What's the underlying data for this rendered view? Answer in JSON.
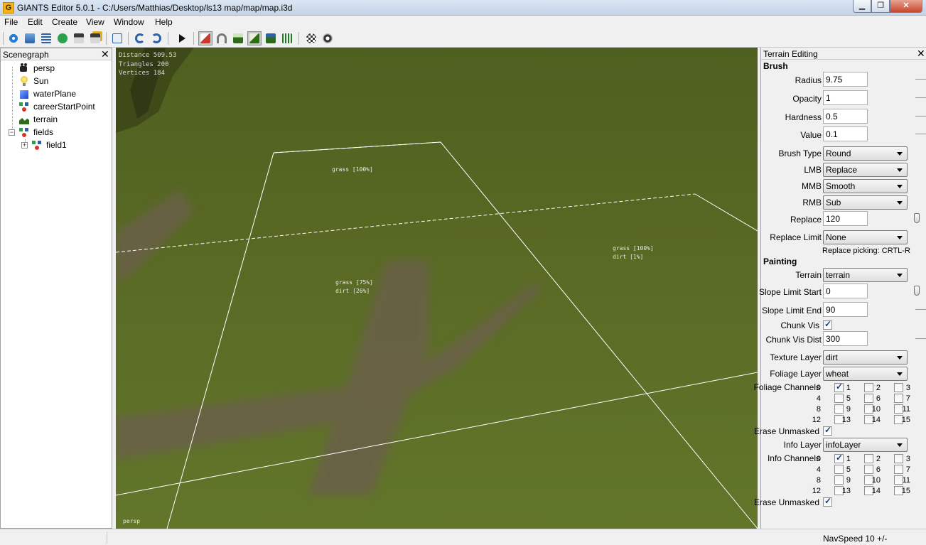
{
  "window": {
    "title": "GIANTS Editor 5.0.1 - C:/Users/Matthias/Desktop/ls13 map/map/map.i3d",
    "app_icon_letter": "G"
  },
  "menu": [
    "File",
    "Edit",
    "Create",
    "View",
    "Window",
    "Help"
  ],
  "toolbar": {
    "icons": [
      "new-scene-icon",
      "open-icon",
      "script-icon",
      "refresh-icon",
      "save-icon",
      "save-as-icon",
      "import-icon",
      "undo-icon",
      "redo-icon",
      "play-icon",
      "select-mode-icon",
      "move-mode-icon",
      "terrain-sculpt-icon",
      "terrain-paint-icon",
      "terrain-foliage-icon",
      "foliage-paint-icon",
      "particle-icon",
      "render-icon"
    ],
    "active": [
      "select-mode-icon",
      "terrain-paint-icon"
    ]
  },
  "scenegraph": {
    "title": "Scenegraph",
    "close": "✕",
    "nodes": [
      {
        "label": "persp",
        "icon": "camera-icon"
      },
      {
        "label": "Sun",
        "icon": "light-bulb-icon"
      },
      {
        "label": "waterPlane",
        "icon": "cube-icon"
      },
      {
        "label": "careerStartPoint",
        "icon": "transform-group-icon"
      },
      {
        "label": "terrain",
        "icon": "terrain-icon"
      },
      {
        "label": "fields",
        "icon": "transform-group-icon"
      },
      {
        "label": "field1",
        "icon": "transform-group-icon"
      }
    ]
  },
  "viewport": {
    "stats": {
      "distance": "Distance 509.53",
      "triangles": "Triangles 200",
      "vertices": "Vertices 184"
    },
    "labels": [
      {
        "line1": "grass [100%]",
        "line2": ""
      },
      {
        "line1": "grass [75%]",
        "line2": "dirt [26%]"
      },
      {
        "line1": "grass [100%]",
        "line2": "dirt [1%]"
      }
    ],
    "camera": "persp"
  },
  "terrain_editing": {
    "title": "Terrain Editing",
    "close": "✕",
    "brush_heading": "Brush",
    "radius_label": "Radius",
    "radius": "9.75",
    "opacity_label": "Opacity",
    "opacity": "1",
    "hardness_label": "Hardness",
    "hardness": "0.5",
    "value_label": "Value",
    "value": "0.1",
    "brush_type_label": "Brush Type",
    "brush_type": "Round",
    "lmb_label": "LMB",
    "lmb": "Replace",
    "mmb_label": "MMB",
    "mmb": "Smooth",
    "rmb_label": "RMB",
    "rmb": "Sub",
    "replace_label": "Replace",
    "replace": "120",
    "replace_limit_label": "Replace Limit",
    "replace_limit": "None",
    "replace_picking": "Replace picking: CRTL-R",
    "painting_heading": "Painting",
    "terrain_label": "Terrain",
    "terrain": "terrain",
    "slope_start_label": "Slope Limit Start",
    "slope_start": "0",
    "slope_end_label": "Slope Limit End",
    "slope_end": "90",
    "chunk_vis_label": "Chunk Vis",
    "chunk_vis_dist_label": "Chunk Vis Dist",
    "chunk_vis_dist": "300",
    "texture_layer_label": "Texture Layer",
    "texture_layer": "dirt",
    "foliage_layer_label": "Foliage Layer",
    "foliage_layer": "wheat",
    "foliage_channels_label": "Foliage Channels",
    "erase_unmasked_label": "Erase Unmasked",
    "info_layer_label": "Info Layer",
    "info_layer": "infoLayer",
    "info_channels_label": "Info Channels",
    "channel_numbers": [
      "0",
      "1",
      "2",
      "3",
      "4",
      "5",
      "6",
      "7",
      "8",
      "9",
      "10",
      "11",
      "12",
      "13",
      "14",
      "15"
    ],
    "foliage_checked": [
      "0"
    ],
    "info_checked": [
      "0"
    ]
  },
  "statusbar": {
    "navspeed": "NavSpeed 10 +/-"
  }
}
